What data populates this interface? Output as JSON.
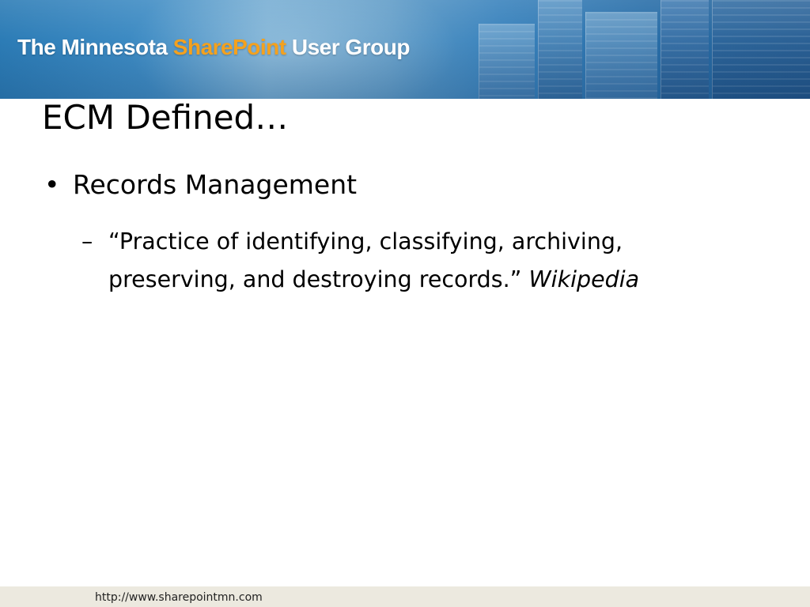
{
  "header": {
    "title_part1": "The Minnesota ",
    "title_highlight": "SharePoint",
    "title_part2": " User Group",
    "highlight_color": "#f4a11e"
  },
  "slide": {
    "title": "ECM Defined…",
    "bullets": [
      {
        "marker": "•",
        "text": "Records Management",
        "sub_bullets": [
          {
            "marker": "–",
            "quote": "“Practice of identifying, classifying, archiving, preserving, and destroying records.”",
            "source": "Wikipedia"
          }
        ]
      }
    ]
  },
  "footer": {
    "url": "http://www.sharepointmn.com"
  }
}
